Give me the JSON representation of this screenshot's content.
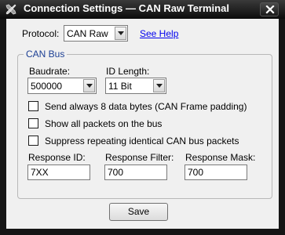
{
  "window": {
    "title": "Connection Settings — CAN Raw Terminal",
    "app_icon": "tools-icon",
    "close_icon": "close-icon"
  },
  "protocol": {
    "label": "Protocol:",
    "value": "CAN Raw",
    "help_link": "See Help"
  },
  "can_bus": {
    "group_title": "CAN Bus",
    "baudrate": {
      "label": "Baudrate:",
      "value": "500000"
    },
    "id_length": {
      "label": "ID Length:",
      "value": "11 Bit"
    },
    "options": [
      {
        "label": "Send always 8 data bytes (CAN Frame padding)",
        "checked": false
      },
      {
        "label": "Show all packets on the bus",
        "checked": false
      },
      {
        "label": "Suppress repeating identical CAN bus packets",
        "checked": false
      }
    ],
    "response_id": {
      "label": "Response ID:",
      "value": "7XX"
    },
    "response_filter": {
      "label": "Response Filter:",
      "value": "700"
    },
    "response_mask": {
      "label": "Response Mask:",
      "value": "700"
    }
  },
  "save_label": "Save",
  "colors": {
    "titlebar": "#0b0b0b",
    "client_bg": "#f0f0f0",
    "group_title": "#1c3f94",
    "link": "#0000ee"
  }
}
